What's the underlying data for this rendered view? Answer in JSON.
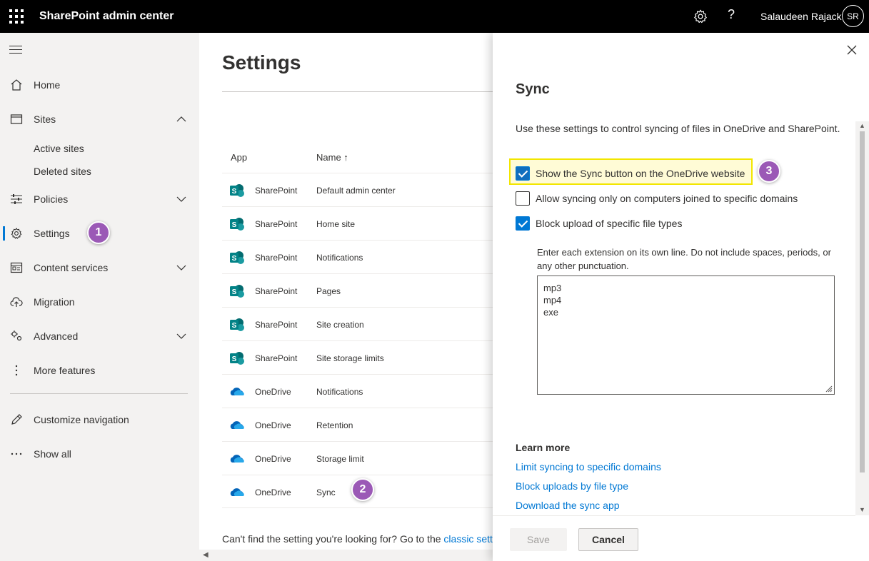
{
  "topbar": {
    "app_title": "SharePoint admin center",
    "user_name": "Salaudeen Rajack",
    "avatar_initials": "SR",
    "help_glyph": "?"
  },
  "nav": {
    "items": [
      {
        "label": "Home"
      },
      {
        "label": "Sites"
      },
      {
        "label": "Active sites"
      },
      {
        "label": "Deleted sites"
      },
      {
        "label": "Policies"
      },
      {
        "label": "Settings"
      },
      {
        "label": "Content services"
      },
      {
        "label": "Migration"
      },
      {
        "label": "Advanced"
      },
      {
        "label": "More features"
      },
      {
        "label": "Customize navigation"
      },
      {
        "label": "Show all"
      }
    ]
  },
  "callouts": [
    "1",
    "2",
    "3"
  ],
  "main": {
    "title": "Settings",
    "col_app": "App",
    "col_name": "Name ↑",
    "rows": [
      {
        "app": "SharePoint",
        "name": "Default admin center"
      },
      {
        "app": "SharePoint",
        "name": "Home site"
      },
      {
        "app": "SharePoint",
        "name": "Notifications"
      },
      {
        "app": "SharePoint",
        "name": "Pages"
      },
      {
        "app": "SharePoint",
        "name": "Site creation"
      },
      {
        "app": "SharePoint",
        "name": "Site storage limits"
      },
      {
        "app": "OneDrive",
        "name": "Notifications"
      },
      {
        "app": "OneDrive",
        "name": "Retention"
      },
      {
        "app": "OneDrive",
        "name": "Storage limit"
      },
      {
        "app": "OneDrive",
        "name": "Sync"
      }
    ],
    "footer_text": "Can't find the setting you're looking for? Go to the ",
    "footer_link": "classic settings page"
  },
  "panel": {
    "title": "Sync",
    "description": "Use these settings to control syncing of files in OneDrive and SharePoint.",
    "options": [
      {
        "label": "Show the Sync button on the OneDrive website",
        "checked": true
      },
      {
        "label": "Allow syncing only on computers joined to specific domains",
        "checked": false
      },
      {
        "label": "Block upload of specific file types",
        "checked": true
      }
    ],
    "ext_help": "Enter each extension on its own line. Do not include spaces, periods, or any other punctuation.",
    "extensions": [
      "mp3",
      "mp4",
      "exe"
    ],
    "learn_more": "Learn more",
    "links": [
      "Limit syncing to specific domains",
      "Block uploads by file type",
      "Download the sync app"
    ],
    "save_label": "Save",
    "cancel_label": "Cancel"
  },
  "colors": {
    "accent": "#0078d4",
    "callout": "#9b59b6",
    "highlight_border": "#f2e600",
    "sharepoint_green": "#038387",
    "onedrive_blue": "#0364b8"
  }
}
